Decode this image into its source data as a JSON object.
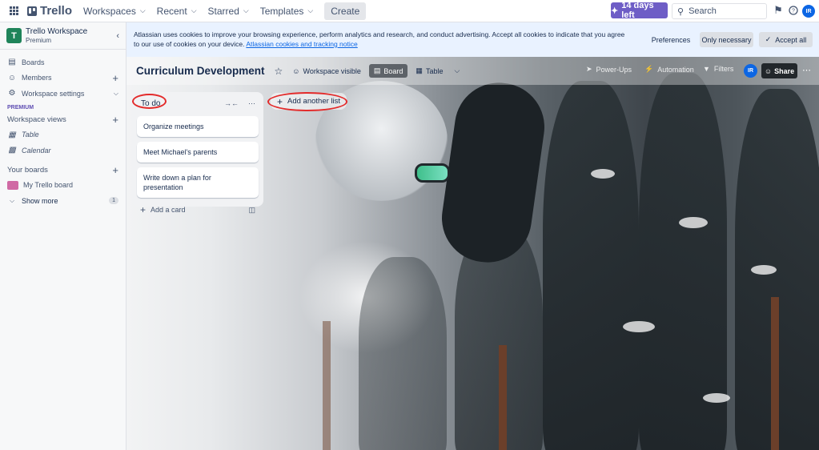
{
  "topnav": {
    "logo": "Trello",
    "workspaces": "Workspaces",
    "recent": "Recent",
    "starred": "Starred",
    "templates": "Templates",
    "create": "Create",
    "trial": "14 days left",
    "search_placeholder": "Search",
    "avatar": "IR"
  },
  "sidebar": {
    "workspace_name": "Trello Workspace",
    "workspace_plan": "Premium",
    "items": [
      {
        "label": "Boards"
      },
      {
        "label": "Members"
      },
      {
        "label": "Workspace settings"
      }
    ],
    "premium_tag": "PREMIUM",
    "workspace_views_title": "Workspace views",
    "views": [
      {
        "label": "Table"
      },
      {
        "label": "Calendar"
      }
    ],
    "your_boards_title": "Your boards",
    "boards": [
      {
        "label": "My Trello board",
        "color": "#d06aa4"
      }
    ],
    "show_more": "Show more",
    "show_more_count": "1"
  },
  "cookie_banner": {
    "text": "Atlassian uses cookies to improve your browsing experience, perform analytics and research, and conduct advertising. Accept all cookies to indicate that you agree to our use of cookies on your device.",
    "link": "Atlassian cookies and tracking notice",
    "preferences": "Preferences",
    "only_necessary": "Only necessary",
    "accept_all": "Accept all"
  },
  "board": {
    "title": "Curriculum Development",
    "visibility": "Workspace visible",
    "view_board": "Board",
    "view_table": "Table",
    "power_ups": "Power-Ups",
    "automation": "Automation",
    "filters": "Filters",
    "avatar": "IR",
    "share": "Share",
    "lists": [
      {
        "title": "To do",
        "cards": [
          {
            "title": "Organize meetings"
          },
          {
            "title": "Meet Michael's parents"
          },
          {
            "title": "Write down a plan for presentation"
          }
        ],
        "add_card": "Add a card"
      }
    ],
    "add_list": "Add another list"
  },
  "colors": {
    "accent": "#0c66e4",
    "trial": "#6e5dc6",
    "annotation": "#e32b2b"
  }
}
